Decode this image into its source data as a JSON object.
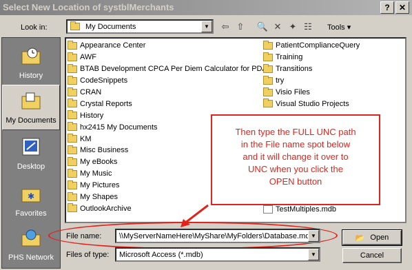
{
  "window": {
    "title": "Select New Location of systblMerchants"
  },
  "titlebar": {
    "help": "?",
    "close": "✕"
  },
  "lookin": {
    "label": "Look in:",
    "value": "My Documents"
  },
  "tools": {
    "label": "Tools"
  },
  "places": [
    {
      "label": "History"
    },
    {
      "label": "My Documents"
    },
    {
      "label": "Desktop"
    },
    {
      "label": "Favorites"
    },
    {
      "label": "PHS Network"
    }
  ],
  "files_left": [
    "Appearance Center",
    "AWF",
    "BTAB Development CPCA Per Diem Calculator for PDA",
    "CodeSnippets",
    "CRAN",
    "Crystal Reports",
    "History",
    "hx2415 My Documents",
    "KM",
    "Misc Business",
    "My eBooks",
    "My Music",
    "My Pictures",
    "My Shapes",
    "OutlookArchive"
  ],
  "files_right": [
    "PatientComplianceQuery",
    "Training",
    "Transitions",
    "try",
    "Visio Files",
    "Visual Studio Projects"
  ],
  "partial_file": "TestMultiples.mdb",
  "callout": {
    "line1": "Then type the FULL UNC path",
    "line2": "in the File name spot below",
    "line3": "and it will change it over to",
    "line4": "UNC when you click the",
    "line5": "OPEN button"
  },
  "filename": {
    "label": "File name:",
    "value": "\\\\MyServerNameHere\\MyShare\\MyFolders\\Database.mdb"
  },
  "filetype": {
    "label": "Files of type:",
    "value": "Microsoft Access (*.mdb)"
  },
  "buttons": {
    "open": "Open",
    "cancel": "Cancel"
  },
  "colors": {
    "annotation": "#e0241c",
    "dialog": "#d4d0c8",
    "places_bar": "#808080"
  }
}
